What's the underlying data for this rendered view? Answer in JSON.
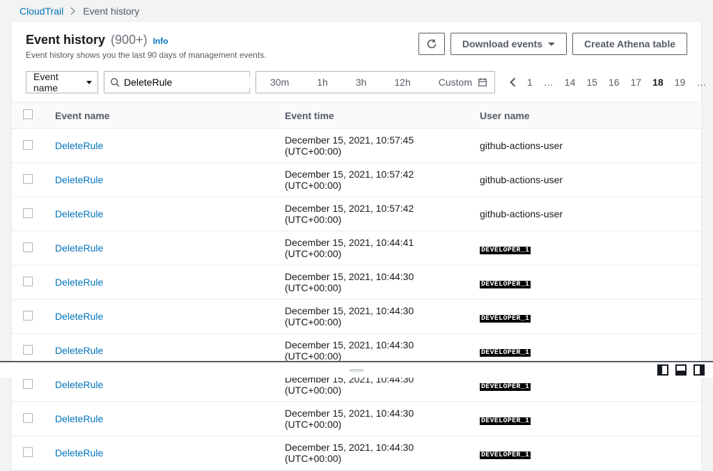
{
  "breadcrumbs": {
    "root": "CloudTrail",
    "current": "Event history"
  },
  "header": {
    "title": "Event history",
    "count": "(900+)",
    "info": "Info",
    "subtitle": "Event history shows you the last 90 days of management events.",
    "download": "Download events",
    "athena": "Create Athena table"
  },
  "filter": {
    "attribute": "Event name",
    "value": "DeleteRule"
  },
  "range": {
    "r30m": "30m",
    "r1h": "1h",
    "r3h": "3h",
    "r12h": "12h",
    "custom": "Custom"
  },
  "pager": {
    "p1": "1",
    "dots1": "…",
    "p14": "14",
    "p15": "15",
    "p16": "16",
    "p17": "17",
    "p18": "18",
    "p19": "19",
    "dots2": "…"
  },
  "columns": {
    "event": "Event name",
    "time": "Event time",
    "user": "User name"
  },
  "rows": [
    {
      "event": "DeleteRule",
      "time": "December 15, 2021, 10:57:45 (UTC+00:00)",
      "user": "github-actions-user",
      "redacted": false
    },
    {
      "event": "DeleteRule",
      "time": "December 15, 2021, 10:57:42 (UTC+00:00)",
      "user": "github-actions-user",
      "redacted": false
    },
    {
      "event": "DeleteRule",
      "time": "December 15, 2021, 10:57:42 (UTC+00:00)",
      "user": "github-actions-user",
      "redacted": false
    },
    {
      "event": "DeleteRule",
      "time": "December 15, 2021, 10:44:41 (UTC+00:00)",
      "user": "DEVELOPER_1",
      "redacted": true
    },
    {
      "event": "DeleteRule",
      "time": "December 15, 2021, 10:44:30 (UTC+00:00)",
      "user": "DEVELOPER_1",
      "redacted": true
    },
    {
      "event": "DeleteRule",
      "time": "December 15, 2021, 10:44:30 (UTC+00:00)",
      "user": "DEVELOPER_1",
      "redacted": true
    },
    {
      "event": "DeleteRule",
      "time": "December 15, 2021, 10:44:30 (UTC+00:00)",
      "user": "DEVELOPER_1",
      "redacted": true
    },
    {
      "event": "DeleteRule",
      "time": "December 15, 2021, 10:44:30 (UTC+00:00)",
      "user": "DEVELOPER_1",
      "redacted": true
    },
    {
      "event": "DeleteRule",
      "time": "December 15, 2021, 10:44:30 (UTC+00:00)",
      "user": "DEVELOPER_1",
      "redacted": true
    },
    {
      "event": "DeleteRule",
      "time": "December 15, 2021, 10:44:30 (UTC+00:00)",
      "user": "DEVELOPER_1",
      "redacted": true
    }
  ]
}
